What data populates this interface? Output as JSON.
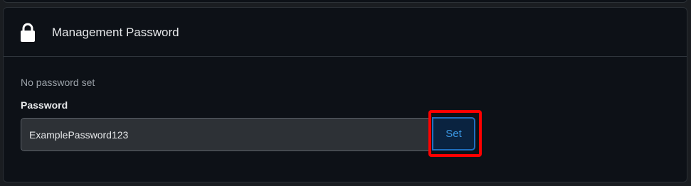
{
  "card": {
    "title": "Management Password",
    "icon": "lock-icon",
    "status": "No password set"
  },
  "form": {
    "password_label": "Password",
    "password_value": "ExamplePassword123",
    "set_button_label": "Set"
  },
  "colors": {
    "background": "#1a1d21",
    "card": "#0d1117",
    "accent": "#1f6fbf",
    "highlight": "#ff0000"
  }
}
